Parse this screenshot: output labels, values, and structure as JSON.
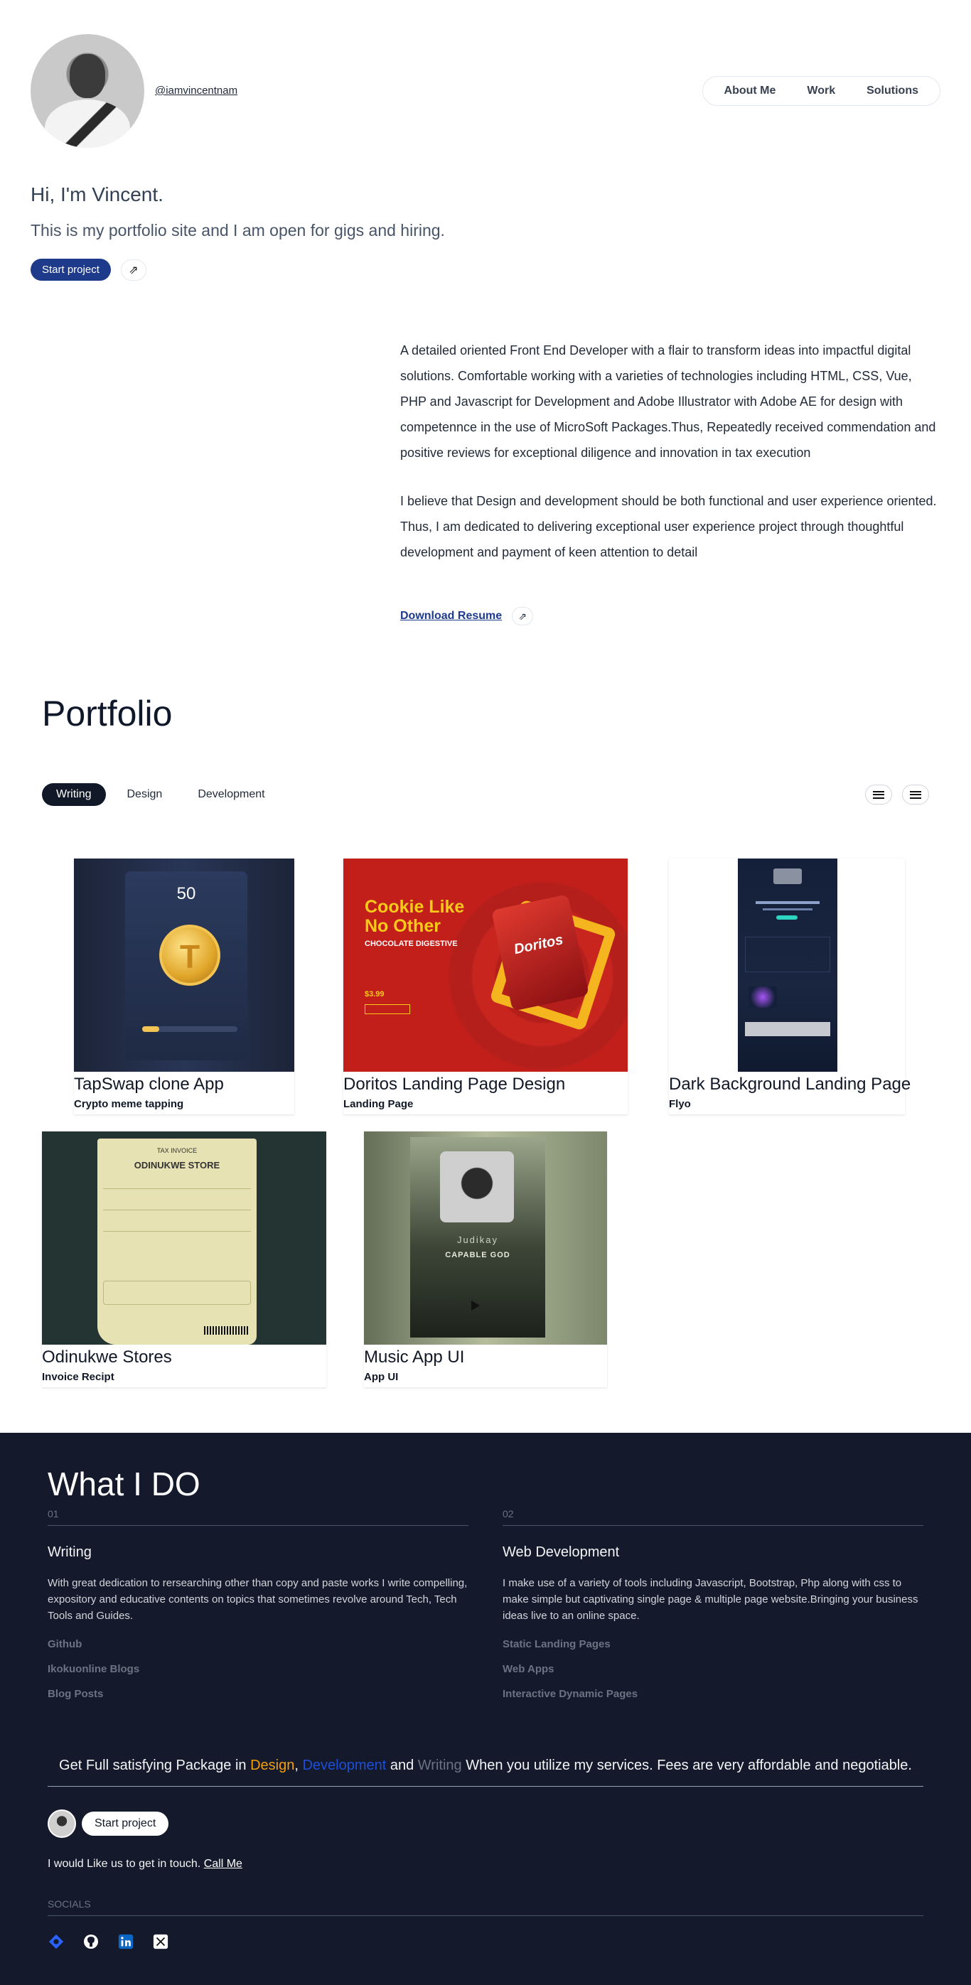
{
  "header": {
    "handle": "@iamvincentnam",
    "nav": [
      "About Me",
      "Work",
      "Solutions"
    ]
  },
  "hero": {
    "title": "Hi, I'm Vincent.",
    "subtitle": "This is my portfolio site and I am open for gigs and hiring.",
    "start_button": "Start project",
    "arrow": "⇗"
  },
  "about": {
    "p1": "A detailed oriented Front End Developer with a flair to transform ideas into impactful digital solutions. Comfortable working with a varieties of technologies including HTML, CSS, Vue, PHP and Javascript for Development and Adobe Illustrator with Adobe AE for design with competennce in the use of MicroSoft Packages.Thus, Repeatedly received commendation and positive reviews for exceptional diligence and innovation in tax execution",
    "p2": "I believe that Design and development should be both functional and user experience oriented. Thus, I am dedicated to delivering exceptional user experience project through thoughtful development and payment of keen attention to detail",
    "resume_link": "Download Resume"
  },
  "portfolio": {
    "title": "Portfolio",
    "tabs": [
      "Writing",
      "Design",
      "Development"
    ],
    "active_tab": "Writing",
    "items": [
      {
        "title": "TapSwap clone App",
        "subtitle": "Crypto meme tapping",
        "thumb_text": "50"
      },
      {
        "title": "Doritos Landing Page Design",
        "subtitle": "Landing Page",
        "thumb_heading": "Cookie Like No Other",
        "thumb_sub": "CHOCOLATE DIGESTIVE",
        "thumb_price": "$3.99",
        "thumb_brand": "Doritos"
      },
      {
        "title": "Dark Background Landing Page",
        "subtitle": "Flyo"
      },
      {
        "title": "Odinukwe Stores",
        "subtitle": "Invoice Recipt",
        "thumb_label": "TAX INVOICE",
        "thumb_store": "ODINUKWE STORE"
      },
      {
        "title": "Music App UI",
        "subtitle": "App UI",
        "thumb_artist": "Judikay",
        "thumb_song": "CAPABLE GOD"
      }
    ]
  },
  "what_i_do": {
    "title": "What I DO",
    "columns": [
      {
        "num": "01",
        "heading": "Writing",
        "desc": "With great dedication to rersearching other than copy and paste works I write compelling, expository and educative contents on topics that sometimes revolve around Tech, Tech Tools and Guides.",
        "links": [
          "Github",
          "Ikokuonline Blogs",
          "Blog Posts"
        ]
      },
      {
        "num": "02",
        "heading": "Web Development",
        "desc": "I make use of a variety of tools including Javascript, Bootstrap, Php along with css to make simple but captivating single page & multiple page website.Bringing your business ideas live to an online space.",
        "links": [
          "Static Landing Pages",
          "Web Apps",
          "Interactive Dynamic Pages"
        ]
      }
    ],
    "package": {
      "pre": "Get Full satisfying Package in ",
      "design": "Design",
      "sep": ", ",
      "development": "Development",
      "and": " and ",
      "writing": "Writing",
      "post": " When you utilize my services. Fees are very affordable and negotiable."
    },
    "cta_button": "Start project",
    "touch_text": "I would Like us to get in touch. ",
    "call_me": "Call Me",
    "socials_label": "SOCIALS",
    "social_icons": [
      "hashnode-icon",
      "github-icon",
      "linkedin-icon",
      "x-icon"
    ]
  },
  "colors": {
    "primary": "#1e3a8a",
    "footer_bg": "#141a2b",
    "accent_orange": "#f59e0b",
    "accent_blue": "#1d4ed8"
  }
}
